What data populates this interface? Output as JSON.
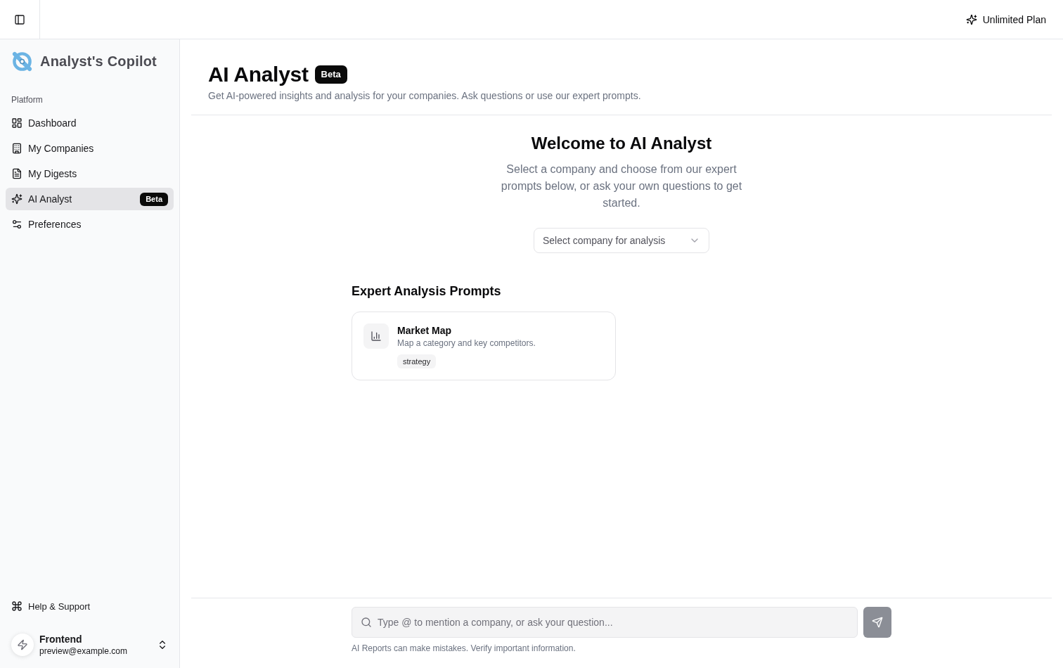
{
  "topbar": {
    "plan_label": "Unlimited Plan"
  },
  "sidebar": {
    "brand": "Analyst's Copilot",
    "section_label": "Platform",
    "items": [
      {
        "label": "Dashboard",
        "selected": false
      },
      {
        "label": "My Companies",
        "selected": false
      },
      {
        "label": "My Digests",
        "selected": false
      },
      {
        "label": "AI Analyst",
        "selected": true,
        "badge": "Beta"
      },
      {
        "label": "Preferences",
        "selected": false
      }
    ],
    "help_link": "Help & Support",
    "user": {
      "name": "Frontend",
      "email": "preview@example.com"
    }
  },
  "page_header": {
    "title": "AI Analyst",
    "badge": "Beta",
    "subtitle": "Get AI-powered insights and analysis for your companies. Ask questions or use our expert prompts."
  },
  "welcome": {
    "title": "Welcome to AI Analyst",
    "text": "Select a company and choose from our expert prompts below, or ask your own questions to get started.",
    "company_select": {
      "placeholder": "Select company for analysis"
    }
  },
  "prompts": {
    "heading": "Expert Analysis Prompts",
    "cards": [
      {
        "title": "Market Map",
        "description": "Map a category and key competitors.",
        "tag": "strategy"
      }
    ]
  },
  "composer": {
    "placeholder": "Type @ to mention a company, or ask your question...",
    "send_button": {
      "disabled": true
    },
    "disclaimer": "AI Reports can make mistakes. Verify important information."
  }
}
